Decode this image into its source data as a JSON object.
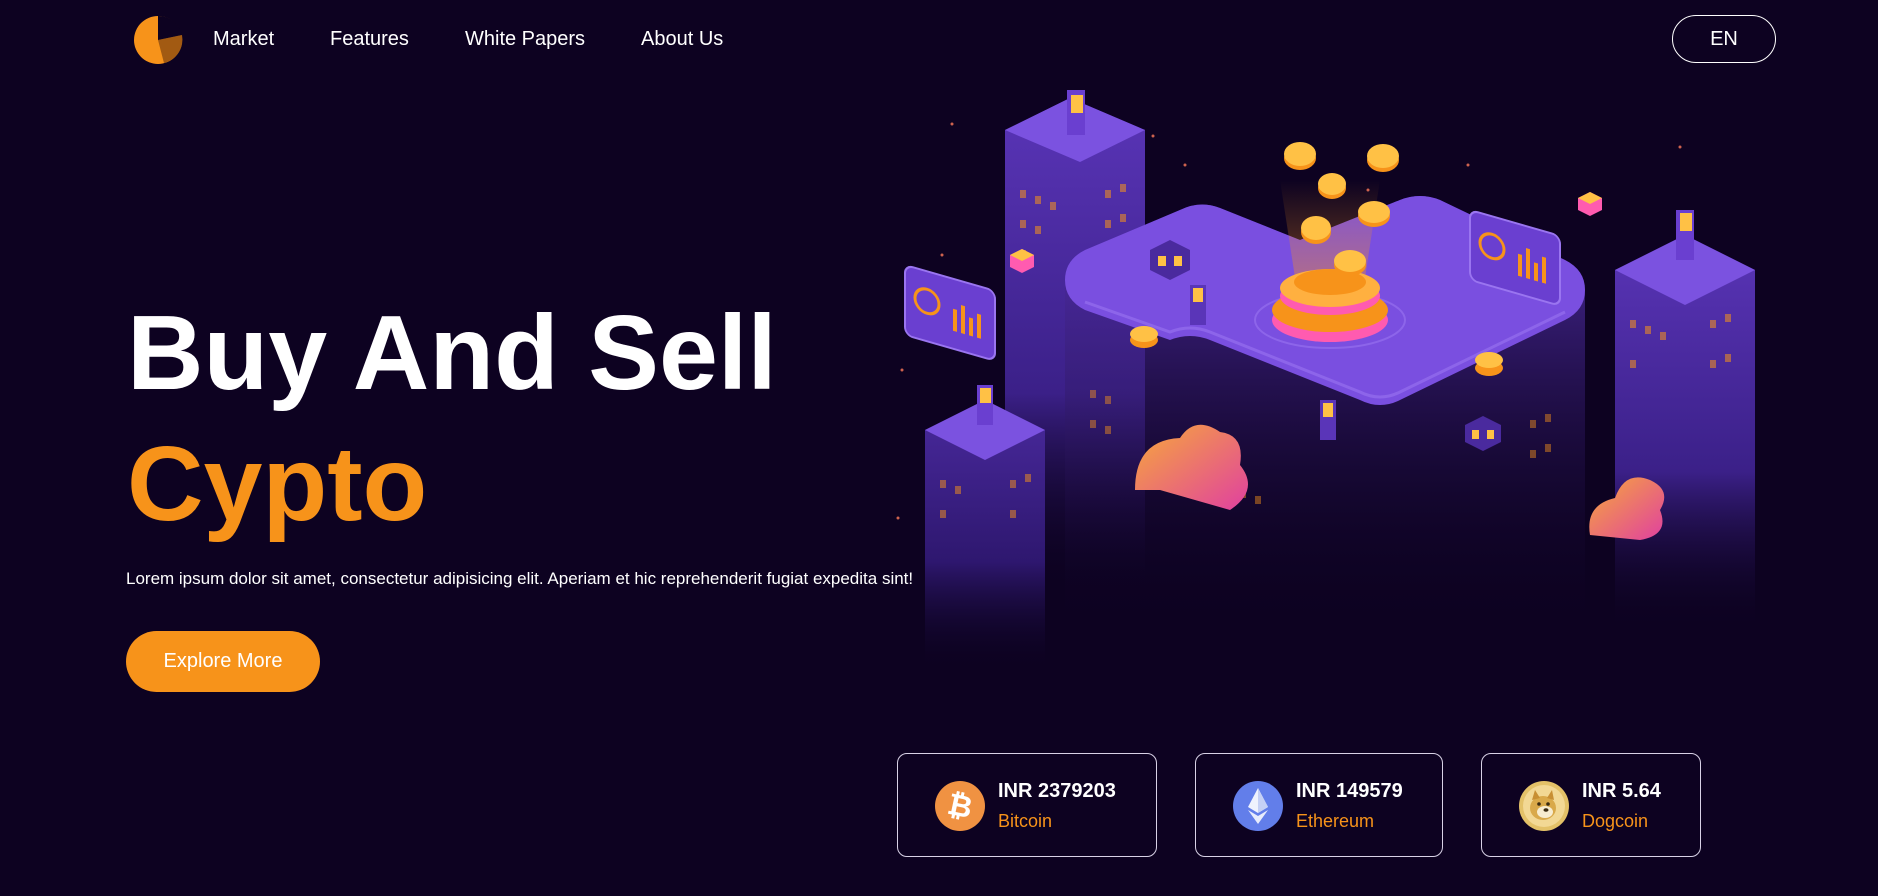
{
  "nav": {
    "links": [
      "Market",
      "Features",
      "White Papers",
      "About Us"
    ],
    "language": "EN"
  },
  "hero": {
    "title_line1": "Buy And Sell",
    "title_line2": "Cypto",
    "description": "Lorem ipsum dolor sit amet, consectetur adipisicing elit. Aperiam et hic reprehenderit fugiat expedita sint!",
    "cta_label": "Explore More"
  },
  "coins": [
    {
      "price": "INR 2379203",
      "name": "Bitcoin",
      "icon": "bitcoin-icon"
    },
    {
      "price": "INR 149579",
      "name": "Ethereum",
      "icon": "ethereum-icon"
    },
    {
      "price": "INR 5.64",
      "name": "Dogcoin",
      "icon": "dogecoin-icon"
    }
  ],
  "colors": {
    "background": "#0d0221",
    "accent": "#f7931a",
    "illustration_purple": "#6a3fd0"
  }
}
